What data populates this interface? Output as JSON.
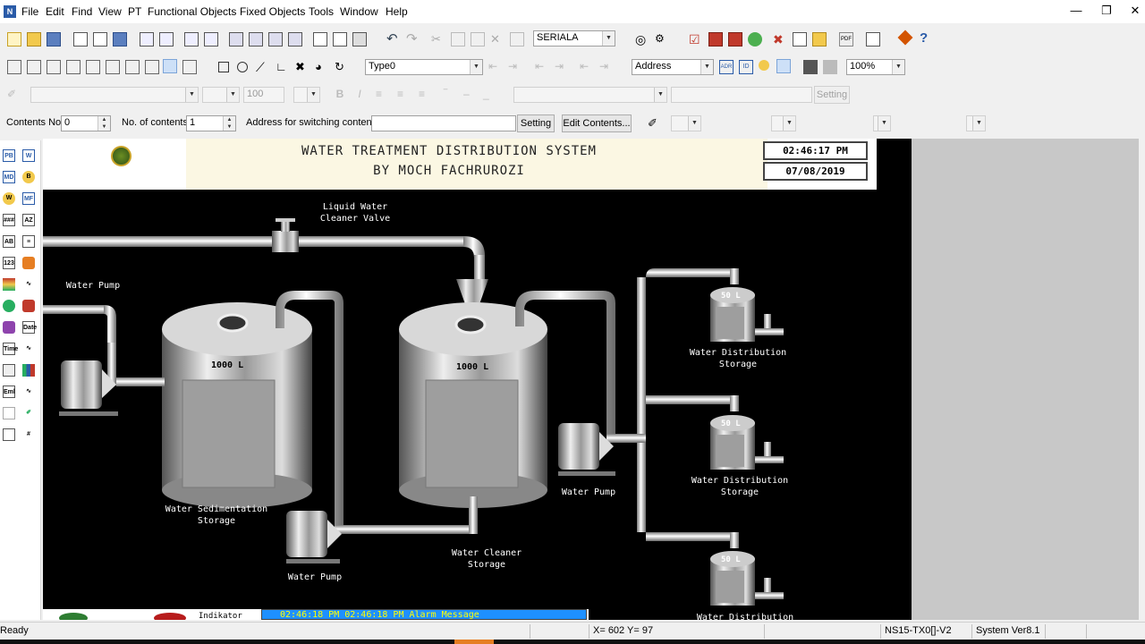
{
  "menu": {
    "items": [
      "File",
      "Edit",
      "Find",
      "View",
      "PT",
      "Functional Objects",
      "Fixed Objects",
      "Tools",
      "Window",
      "Help"
    ]
  },
  "toolbar1": {
    "port_select": "SERIALA"
  },
  "toolbar2": {
    "type_select": "Type0",
    "address_select": "Address",
    "zoom_select": "100%"
  },
  "toolbar3": {
    "font_size": "100",
    "setting_label": "Setting"
  },
  "contents_bar": {
    "contents_no_label": "Contents No.",
    "contents_no_value": "0",
    "no_of_contents_label": "No. of contents",
    "no_of_contents_value": "1",
    "address_label": "Address for switching contents",
    "address_value": "",
    "setting_button": "Setting",
    "edit_button": "Edit Contents..."
  },
  "screen": {
    "title_line1": "WATER TREATMENT DISTRIBUTION SYSTEM",
    "title_line2": "BY MOCH FACHRUROZI",
    "time": "02:46:17 PM",
    "date": "07/08/2019",
    "labels": {
      "valve": "Liquid Water\nCleaner Valve",
      "pump_left": "Water Pump",
      "pump_bottom": "Water Pump",
      "pump_right": "Water Pump",
      "sedimentation": "Water Sedimentation\nStorage",
      "cleaner": "Water Cleaner\nStorage",
      "dist1": "Water Distribution\nStorage",
      "dist2": "Water Distribution\nStorage",
      "dist3": "Water Distribution"
    },
    "tank_capacity_large": "1000 L",
    "tank_capacity_small": "50 L",
    "indicator_label": "Indikator",
    "alarm_text": "02:46:18 PM 02:46:18 PM Alarm Message"
  },
  "status": {
    "ready": "Ready",
    "coords": "X= 602 Y= 97",
    "device": "NS15-TX0[]-V2",
    "system": "System Ver8.1"
  }
}
